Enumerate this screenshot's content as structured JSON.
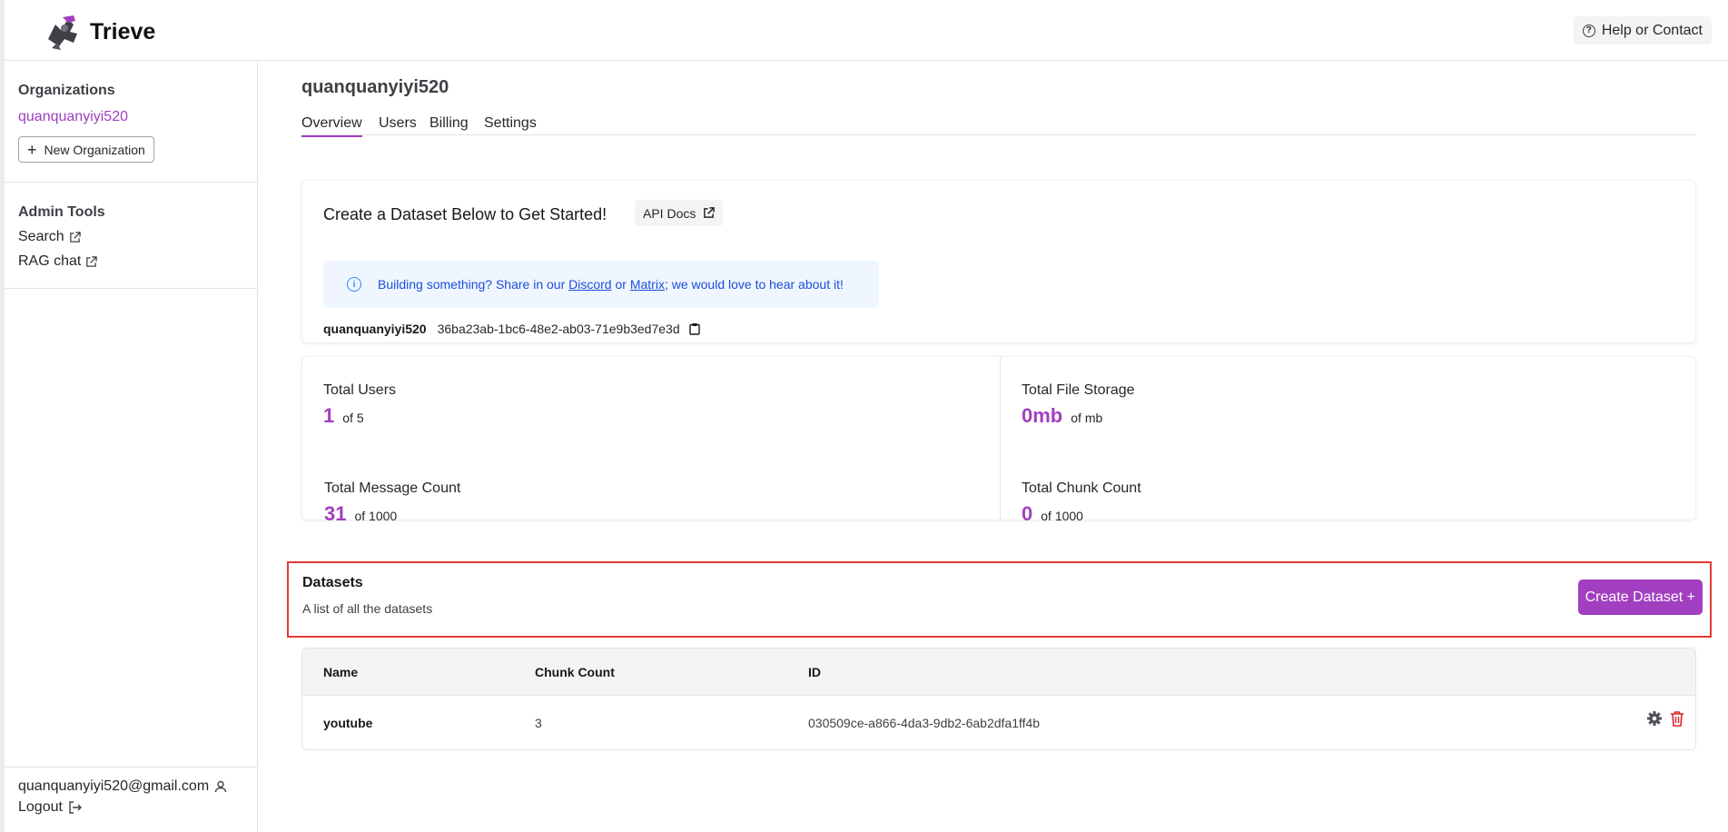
{
  "app": {
    "name": "Trieve"
  },
  "header": {
    "help_label": "Help or Contact"
  },
  "sidebar": {
    "organizations_heading": "Organizations",
    "current_org": "quanquanyiyi520",
    "new_org_label": "New Organization",
    "admin_heading": "Admin Tools",
    "admin_links": [
      {
        "label": "Search"
      },
      {
        "label": "RAG chat"
      }
    ],
    "user_email": "quanquanyiyi520@gmail.com",
    "logout_label": "Logout"
  },
  "main": {
    "org_title": "quanquanyiyi520",
    "tabs": [
      {
        "label": "Overview",
        "active": true
      },
      {
        "label": "Users",
        "active": false
      },
      {
        "label": "Billing",
        "active": false
      },
      {
        "label": "Settings",
        "active": false
      }
    ],
    "create_card": {
      "title": "Create a Dataset Below to Get Started!",
      "api_docs_label": "API Docs",
      "info_prefix": "Building something? Share in our",
      "info_link1": "Discord",
      "info_mid": "or",
      "info_link2": "Matrix",
      "info_suffix": "; we would love to hear about it!",
      "org_name": "quanquanyiyi520",
      "org_id": "36ba23ab-1bc6-48e2-ab03-71e9b3ed7e3d"
    },
    "stats": [
      {
        "label": "Total Users",
        "value": "1",
        "of": "of 5"
      },
      {
        "label": "Total File Storage",
        "value": "0mb",
        "of": "of mb"
      },
      {
        "label": "Total Message Count",
        "value": "31",
        "of": "of 1000"
      },
      {
        "label": "Total Chunk Count",
        "value": "0",
        "of": "of 1000"
      }
    ],
    "datasets": {
      "title": "Datasets",
      "subtitle": "A list of all the datasets",
      "create_label": "Create Dataset +",
      "columns": [
        "Name",
        "Chunk Count",
        "ID"
      ],
      "rows": [
        {
          "name": "youtube",
          "chunk_count": "3",
          "id": "030509ce-a866-4da3-9db2-6ab2dfa1ff4b"
        }
      ]
    }
  },
  "colors": {
    "accent": "#a13fc0",
    "highlight_border": "#e53935",
    "info_text": "#1d4ed8"
  }
}
